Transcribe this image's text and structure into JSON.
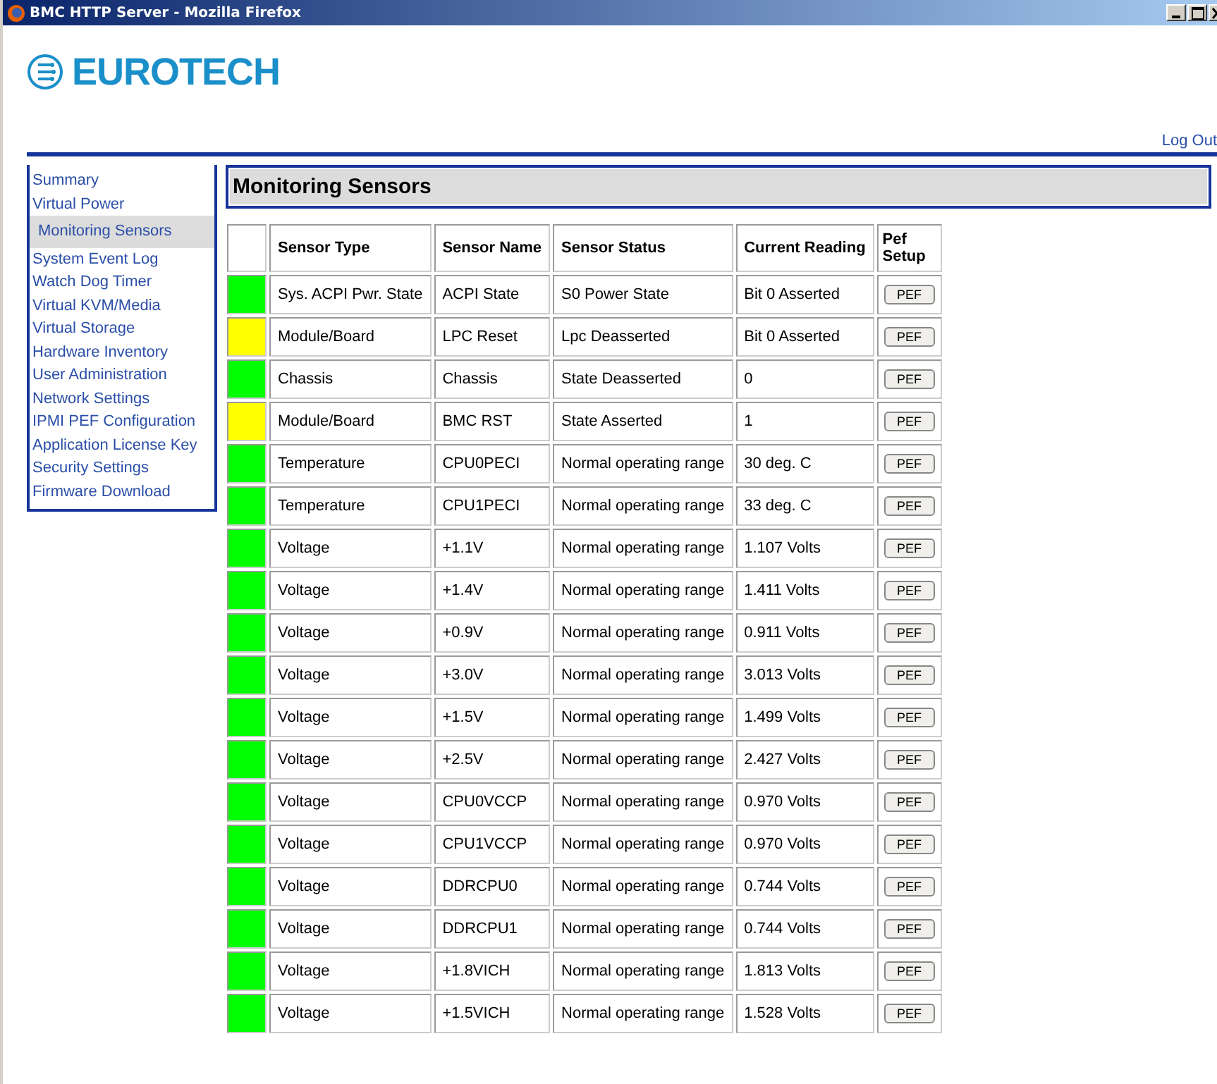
{
  "window": {
    "title": "BMC HTTP Server - Mozilla Firefox"
  },
  "logo": {
    "text": "EUROTECH"
  },
  "logout": "Log Out",
  "sidebar": {
    "items": [
      {
        "label": "Summary",
        "selected": false
      },
      {
        "label": "Virtual Power",
        "selected": false
      },
      {
        "label": "Monitoring Sensors",
        "selected": true
      },
      {
        "label": "System Event Log",
        "selected": false
      },
      {
        "label": "Watch Dog Timer",
        "selected": false
      },
      {
        "label": "Virtual KVM/Media",
        "selected": false
      },
      {
        "label": "Virtual Storage",
        "selected": false
      },
      {
        "label": "Hardware Inventory",
        "selected": false
      },
      {
        "label": "User Administration",
        "selected": false
      },
      {
        "label": "Network Settings",
        "selected": false
      },
      {
        "label": "IPMI PEF Configuration",
        "selected": false
      },
      {
        "label": "Application License Key",
        "selected": false
      },
      {
        "label": "Security Settings",
        "selected": false
      },
      {
        "label": "Firmware Download",
        "selected": false
      }
    ]
  },
  "heading": "Monitoring Sensors",
  "table": {
    "columns": [
      "Sensor Type",
      "Sensor Name",
      "Sensor Status",
      "Current Reading",
      "Pef Setup"
    ],
    "rows": [
      {
        "color": "#00ff00",
        "type": "Sys. ACPI Pwr. State",
        "name": "ACPI State",
        "status": "S0 Power State",
        "reading": "Bit 0 Asserted",
        "button": "PEF"
      },
      {
        "color": "#ffff00",
        "type": "Module/Board",
        "name": "LPC Reset",
        "status": "Lpc Deasserted",
        "reading": "Bit 0 Asserted",
        "button": "PEF"
      },
      {
        "color": "#00ff00",
        "type": "Chassis",
        "name": "Chassis",
        "status": "State Deasserted",
        "reading": "0",
        "button": "PEF"
      },
      {
        "color": "#ffff00",
        "type": "Module/Board",
        "name": "BMC RST",
        "status": "State Asserted",
        "reading": "1",
        "button": "PEF"
      },
      {
        "color": "#00ff00",
        "type": "Temperature",
        "name": "CPU0PECI",
        "status": "Normal operating range",
        "reading": "30 deg. C",
        "button": "PEF"
      },
      {
        "color": "#00ff00",
        "type": "Temperature",
        "name": "CPU1PECI",
        "status": "Normal operating range",
        "reading": "33 deg. C",
        "button": "PEF"
      },
      {
        "color": "#00ff00",
        "type": "Voltage",
        "name": "+1.1V",
        "status": "Normal operating range",
        "reading": "1.107 Volts",
        "button": "PEF"
      },
      {
        "color": "#00ff00",
        "type": "Voltage",
        "name": "+1.4V",
        "status": "Normal operating range",
        "reading": "1.411 Volts",
        "button": "PEF"
      },
      {
        "color": "#00ff00",
        "type": "Voltage",
        "name": "+0.9V",
        "status": "Normal operating range",
        "reading": "0.911 Volts",
        "button": "PEF"
      },
      {
        "color": "#00ff00",
        "type": "Voltage",
        "name": "+3.0V",
        "status": "Normal operating range",
        "reading": "3.013 Volts",
        "button": "PEF"
      },
      {
        "color": "#00ff00",
        "type": "Voltage",
        "name": "+1.5V",
        "status": "Normal operating range",
        "reading": "1.499 Volts",
        "button": "PEF"
      },
      {
        "color": "#00ff00",
        "type": "Voltage",
        "name": "+2.5V",
        "status": "Normal operating range",
        "reading": "2.427 Volts",
        "button": "PEF"
      },
      {
        "color": "#00ff00",
        "type": "Voltage",
        "name": "CPU0VCCP",
        "status": "Normal operating range",
        "reading": "0.970 Volts",
        "button": "PEF"
      },
      {
        "color": "#00ff00",
        "type": "Voltage",
        "name": "CPU1VCCP",
        "status": "Normal operating range",
        "reading": "0.970 Volts",
        "button": "PEF"
      },
      {
        "color": "#00ff00",
        "type": "Voltage",
        "name": "DDRCPU0",
        "status": "Normal operating range",
        "reading": "0.744 Volts",
        "button": "PEF"
      },
      {
        "color": "#00ff00",
        "type": "Voltage",
        "name": "DDRCPU1",
        "status": "Normal operating range",
        "reading": "0.744 Volts",
        "button": "PEF"
      },
      {
        "color": "#00ff00",
        "type": "Voltage",
        "name": "+1.8VICH",
        "status": "Normal operating range",
        "reading": "1.813 Volts",
        "button": "PEF"
      },
      {
        "color": "#00ff00",
        "type": "Voltage",
        "name": "+1.5VICH",
        "status": "Normal operating range",
        "reading": "1.528 Volts",
        "button": "PEF"
      }
    ]
  }
}
